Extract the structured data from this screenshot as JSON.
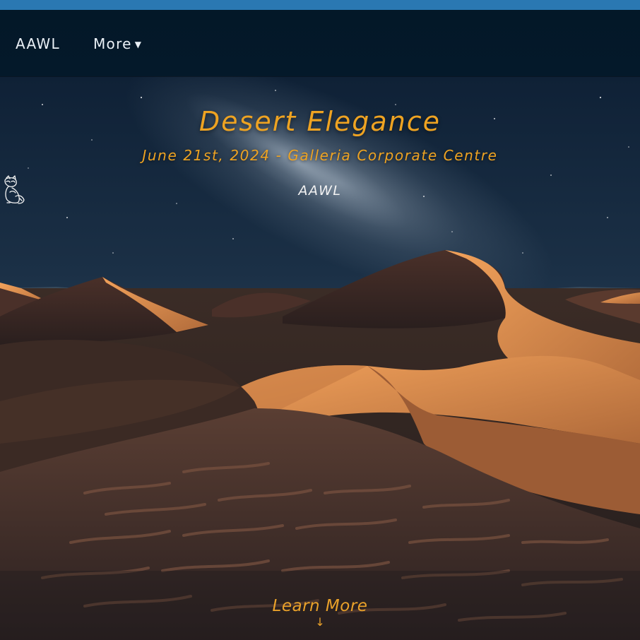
{
  "nav": {
    "brand": "AAWL",
    "more_label": "More"
  },
  "hero": {
    "title": "Desert Elegance",
    "subtitle": "June 21st, 2024 - Galleria Corporate Centre",
    "logo_text": "AAWL",
    "learn_more": "Learn More",
    "arrow": "↓"
  },
  "colors": {
    "top_bar": "#2a78b2",
    "nav_bg": "#031828",
    "accent": "#eea322"
  },
  "icons": {
    "caret": "caret-down-icon",
    "logo": "raccoon-logo-icon",
    "arrow": "arrow-down-icon"
  }
}
